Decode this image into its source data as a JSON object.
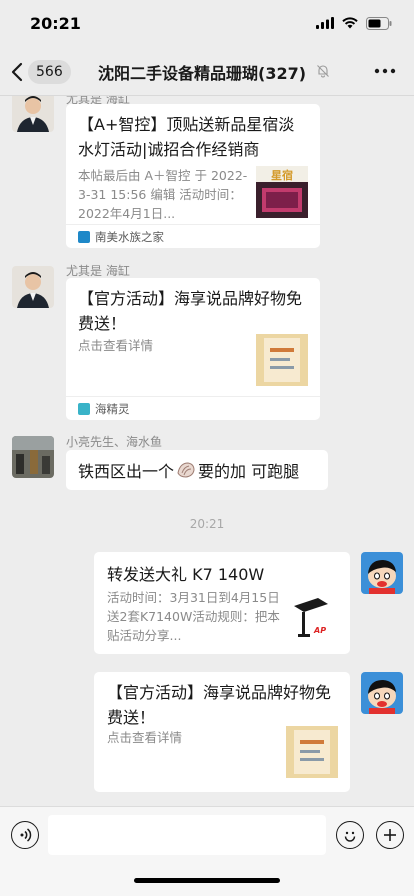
{
  "status_bar": {
    "time": "20:21"
  },
  "nav": {
    "back_count": "566",
    "title": "沈阳二手设备精品珊瑚(327)",
    "more_icon": "more-dots-icon"
  },
  "messages": [
    {
      "sender": "尤其是 海缸",
      "card": {
        "title": "【A+智控】顶贴送新品星宿淡水灯活动|诚招合作经销商",
        "desc": "本帖最后由 A＋智控 于 2022-3-31 15:56 编辑 活动时间：2022年4月1日...",
        "thumb_text": "星宿",
        "source": "南美水族之家"
      }
    },
    {
      "sender": "尤其是 海缸",
      "card": {
        "title": "【官方活动】海享说品牌好物免费送！",
        "desc": "点击查看详情",
        "source": "海精灵"
      }
    },
    {
      "sender": "小亮先生、海水鱼",
      "text_before": "铁西区出一个",
      "text_after": " 要的加 可跑腿"
    }
  ],
  "timestamp": "20:21",
  "my_messages": [
    {
      "title": "转发送大礼 K7 140W",
      "desc": "活动时间：3月31日到4月15日送2套K7140W活动规则：把本贴活动分享...",
      "thumb_text": "AP"
    },
    {
      "title": "【官方活动】海享说品牌好物免费送！",
      "desc": "点击查看详情"
    }
  ],
  "colors": {
    "background": "#ededed",
    "bubble": "#ffffff",
    "meta_text": "#8a8a8a"
  }
}
